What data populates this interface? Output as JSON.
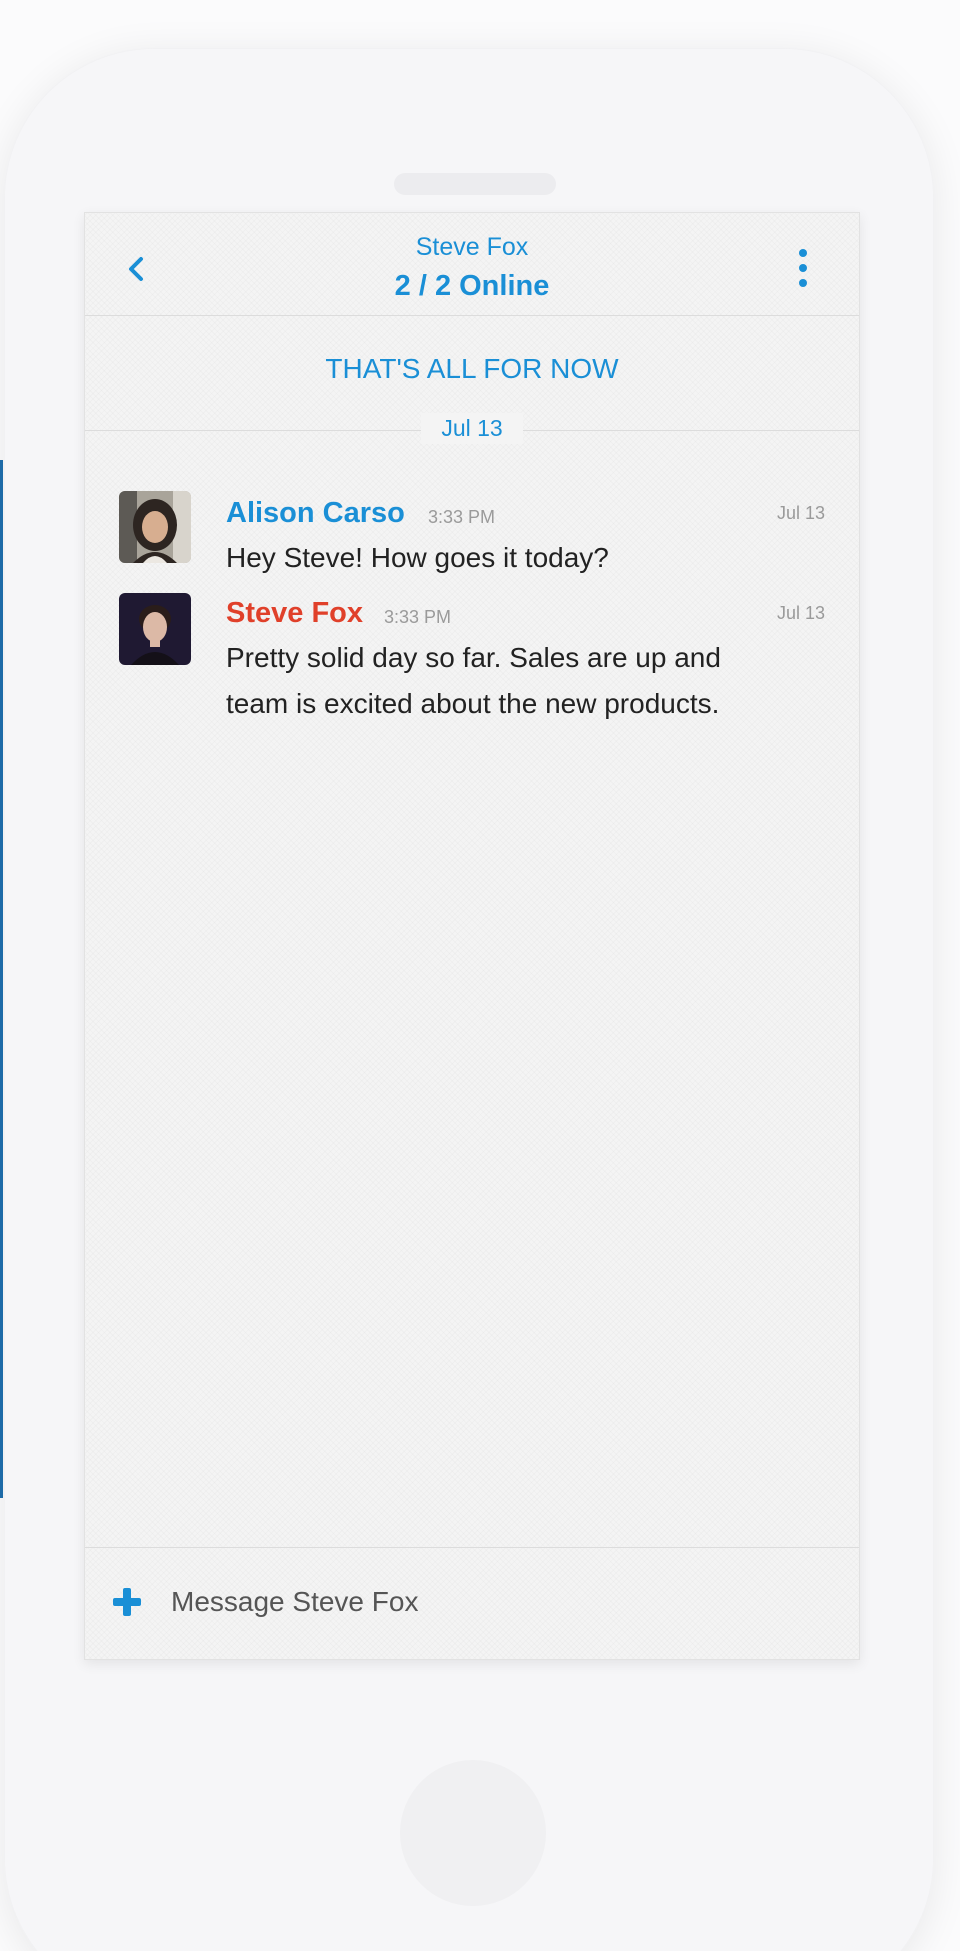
{
  "header": {
    "contact_name": "Steve Fox",
    "online_status": "2 / 2 Online"
  },
  "conversation": {
    "end_banner": "THAT'S ALL FOR NOW",
    "date_divider": "Jul 13",
    "messages": [
      {
        "sender": "Alison Carso",
        "sender_color": "#1a8fd6",
        "time": "3:33 PM",
        "date": "Jul 13",
        "text": "Hey Steve! How goes it today?"
      },
      {
        "sender": "Steve Fox",
        "sender_color": "#e0402a",
        "time": "3:33 PM",
        "date": "Jul 13",
        "text": "Pretty solid day so far. Sales are up and team is excited about the new products."
      }
    ]
  },
  "composer": {
    "placeholder": "Message Steve Fox"
  },
  "icons": {
    "back": "chevron-left-icon",
    "more": "vertical-dots-icon",
    "add": "plus-icon"
  },
  "colors": {
    "accent": "#1a8fd6",
    "sender_self": "#e0402a"
  }
}
